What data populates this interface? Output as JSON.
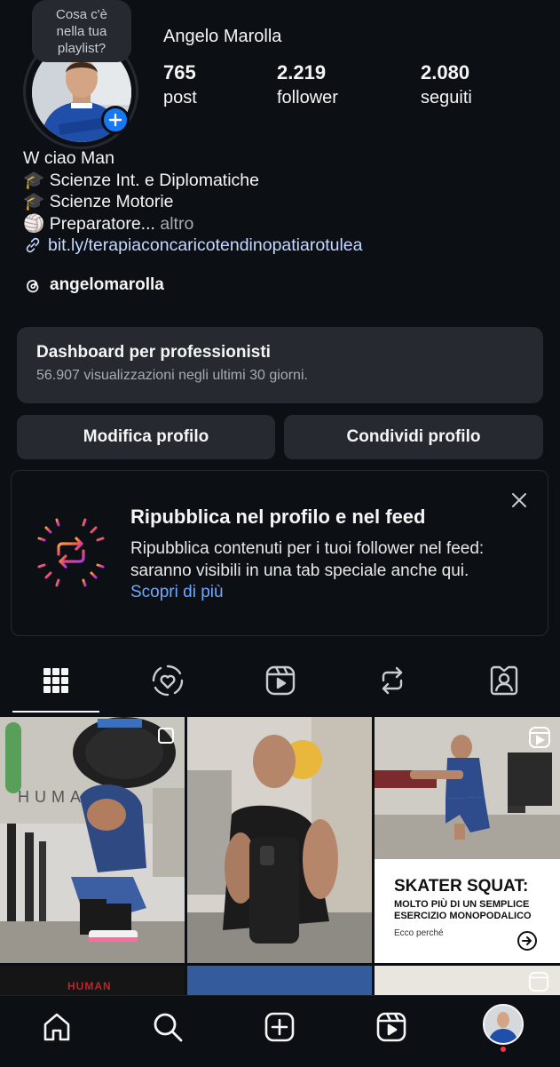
{
  "profile": {
    "name": "Angelo Marolla",
    "note": "Cosa c'è nella tua playlist?",
    "stats": [
      {
        "value": "765",
        "label": "post"
      },
      {
        "value": "2.219",
        "label": "follower"
      },
      {
        "value": "2.080",
        "label": "seguiti"
      }
    ]
  },
  "bio": {
    "line1": "W ciao Man",
    "line2": "🎓 Scienze Int. e Diplomatiche",
    "line3": "🎓 Scienze Motorie",
    "line4": "🏐 Preparatore...",
    "more": "altro",
    "link": "bit.ly/terapiaconcaricotendinopatiarotulea",
    "threads": "angelomarolla"
  },
  "dashboard": {
    "title": "Dashboard per professionisti",
    "subtitle": "56.907 visualizzazioni negli ultimi 30 giorni."
  },
  "buttons": {
    "edit": "Modifica profilo",
    "share": "Condividi profilo"
  },
  "repost_card": {
    "title": "Ripubblica nel profilo e nel feed",
    "body": "Ripubblica contenuti per i tuoi follower nel feed: saranno visibili in una tab speciale anche qui.",
    "link": "Scopri di più"
  },
  "grid": {
    "post3_title": "SKATER SQUAT:",
    "post3_sub": "MOLTO PIÙ DI UN SEMPLICE ESERCIZIO MONOPODALICO",
    "post3_caption": "Ecco perché",
    "post4_label": "HUMAN"
  },
  "icons": [
    "grid-icon",
    "tagged-heart-icon",
    "reels-icon",
    "repost-icon",
    "tagged-user-icon",
    "home-icon",
    "search-icon",
    "create-icon",
    "reels-nav-icon",
    "profile-avatar"
  ],
  "colors": {
    "background": "#0c1014",
    "surface": "#262a30",
    "accent": "#1877f2",
    "link": "#70a8ff"
  }
}
